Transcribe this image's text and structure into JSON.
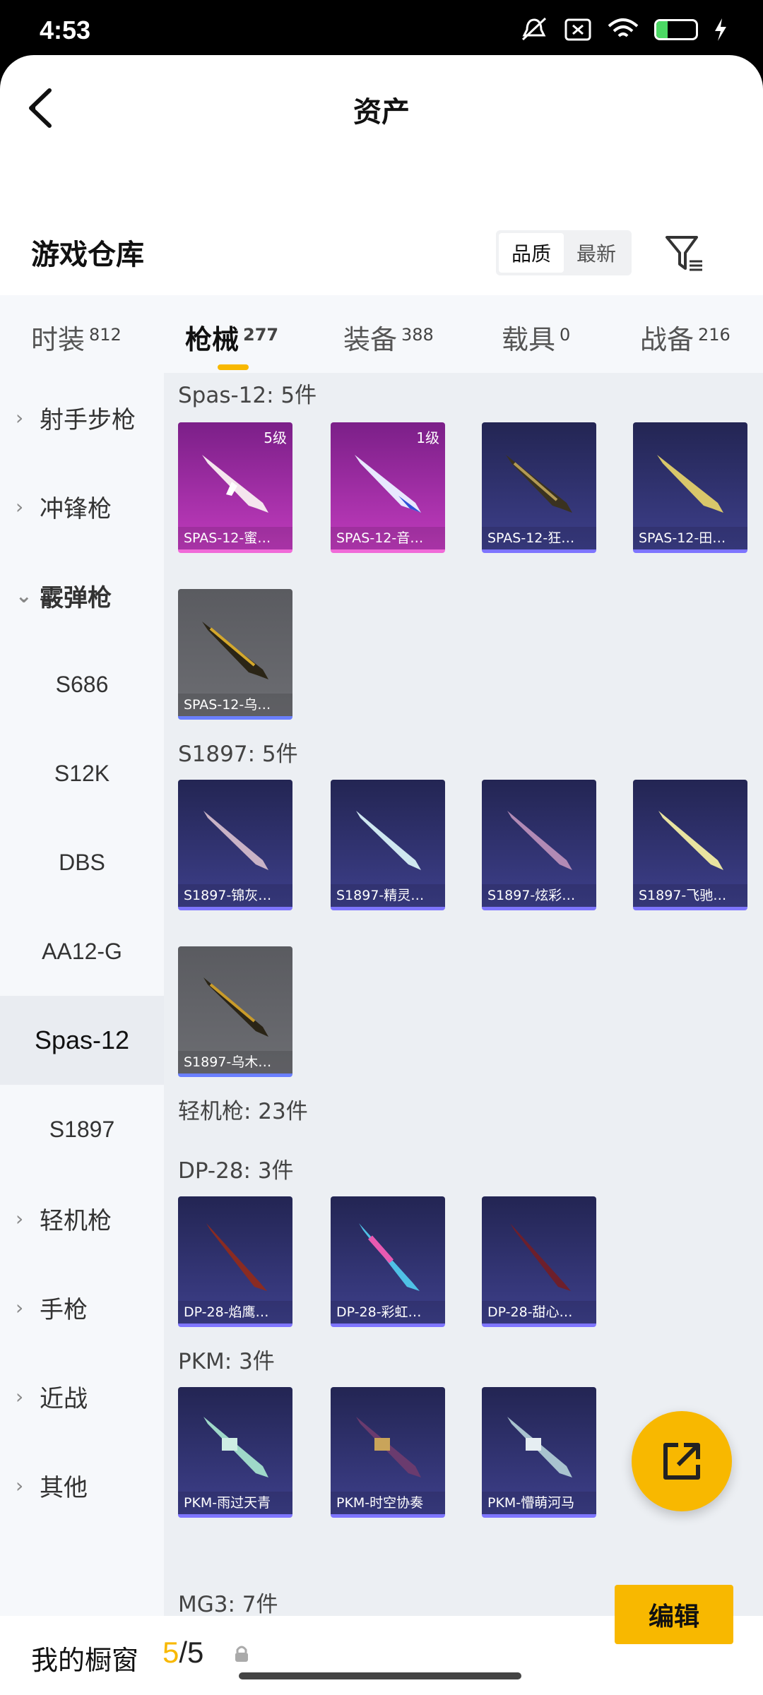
{
  "status_bar": {
    "time": "4:53",
    "battery": "28"
  },
  "header": {
    "title": "资产"
  },
  "warehouse": {
    "label": "游戏仓库",
    "sort_quality": "品质",
    "sort_latest": "最新"
  },
  "tabs": [
    {
      "label": "时装",
      "count": "812"
    },
    {
      "label": "枪械",
      "count": "277"
    },
    {
      "label": "装备",
      "count": "388"
    },
    {
      "label": "载具",
      "count": "0"
    },
    {
      "label": "战备",
      "count": "216"
    }
  ],
  "sidebar": {
    "items": [
      "射手步枪",
      "冲锋枪",
      "霰弹枪",
      "S686",
      "S12K",
      "DBS",
      "AA12-G",
      "Spas-12",
      "S1897",
      "轻机枪",
      "手枪",
      "近战",
      "其他"
    ]
  },
  "groups": {
    "spas": {
      "title": "Spas-12: 5件",
      "cards": [
        {
          "name": "SPAS-12-蜜…",
          "level": "5级"
        },
        {
          "name": "SPAS-12-音…",
          "level": "1级"
        },
        {
          "name": "SPAS-12-狂…"
        },
        {
          "name": "SPAS-12-田…"
        },
        {
          "name": "SPAS-12-乌…"
        }
      ]
    },
    "s1897": {
      "title": "S1897: 5件",
      "cards": [
        {
          "name": "S1897-锦灰…"
        },
        {
          "name": "S1897-精灵…"
        },
        {
          "name": "S1897-炫彩…"
        },
        {
          "name": "S1897-飞驰…"
        },
        {
          "name": "S1897-乌木…"
        }
      ]
    },
    "lmg": {
      "title": "轻机枪: 23件"
    },
    "dp28": {
      "title": "DP-28: 3件",
      "cards": [
        {
          "name": "DP-28-焰鹰…"
        },
        {
          "name": "DP-28-彩虹…"
        },
        {
          "name": "DP-28-甜心…"
        }
      ]
    },
    "pkm": {
      "title": "PKM: 3件",
      "cards": [
        {
          "name": "PKM-雨过天青"
        },
        {
          "name": "PKM-时空协奏"
        },
        {
          "name": "PKM-懵萌河马"
        }
      ]
    },
    "mg3": {
      "title": "MG3: 7件"
    }
  },
  "showcase": {
    "label": "我的橱窗",
    "current": "5",
    "separator": "/",
    "total": "5",
    "edit_label": "编辑"
  },
  "colors": {
    "accent": "#f8b800",
    "pink_card": "#c03bbd",
    "purple_card": "#3d3f8a",
    "gray_card": "#6c6d72"
  }
}
